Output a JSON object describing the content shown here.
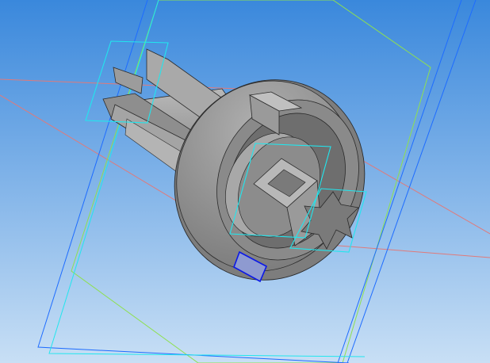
{
  "viewport": {
    "background_top": "#3a88dc",
    "background_bottom": "#c8dff5"
  },
  "model": {
    "shade_light": "#b4b4b4",
    "shade_mid": "#8e8e8e",
    "shade_dark": "#5e5e5e",
    "edge": "#2a2a2a"
  },
  "planes": {
    "cyan": "#21e6ee",
    "blue": "#1e6cff",
    "green": "#8ee050",
    "red": "#e07a7a"
  },
  "selection": {
    "face_color": "#0b18e8"
  }
}
